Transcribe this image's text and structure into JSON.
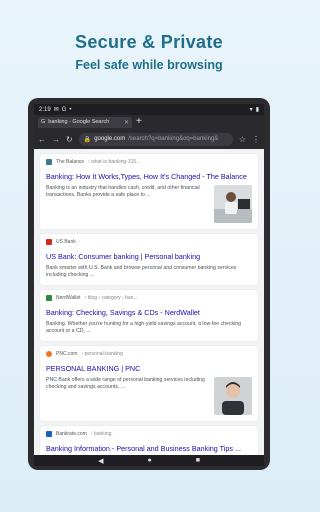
{
  "promo": {
    "headline": "Secure & Private",
    "subheadline": "Feel safe while browsing"
  },
  "statusbar": {
    "time": "2:19"
  },
  "browser": {
    "tab_title": "banking - Google Search",
    "url_main": "google.com",
    "url_rest": "/search?q=banking&oq=banking&"
  },
  "results": [
    {
      "site": "The Balance",
      "crumb": "› what-is-banking-315...",
      "title": "Banking: How It Works,Types, How It's Changed - The Balance",
      "snippet": "Banking is an industry that handles cash, credit, and other financial transactions. Banks provide a safe place to ...",
      "favicon_color": "#3c7a89",
      "thumb": "office-worker"
    },
    {
      "site": "US Bank",
      "crumb": "",
      "title": "US Bank: Consumer banking | Personal banking",
      "snippet": "Bank smarter with U.S. Bank and browse personal and consumer banking services including checking ...",
      "favicon_color": "#d52b1e",
      "thumb": ""
    },
    {
      "site": "NerdWallet",
      "crumb": "› blog › category › ban...",
      "title": "Banking: Checking, Savings & CDs - NerdWallet",
      "snippet": "Banking. Whether you're hunting for a high-yield savings account, a low-fee checking account or a CD, ...",
      "favicon_color": "#2f8a3b",
      "thumb": ""
    },
    {
      "site": "PNC.com",
      "crumb": "› personal-banking",
      "title": "PERSONAL BANKING | PNC",
      "snippet": "PNC Bank offers a wide range of personal banking services including checking and savings accounts, ...",
      "favicon_color": "#ef7622",
      "thumb": "person-portrait"
    },
    {
      "site": "Bankrate.com",
      "crumb": "› banking",
      "title": "Banking Information - Personal and Business Banking Tips ...",
      "snippet": "",
      "favicon_color": "#1565c0",
      "thumb": ""
    }
  ]
}
